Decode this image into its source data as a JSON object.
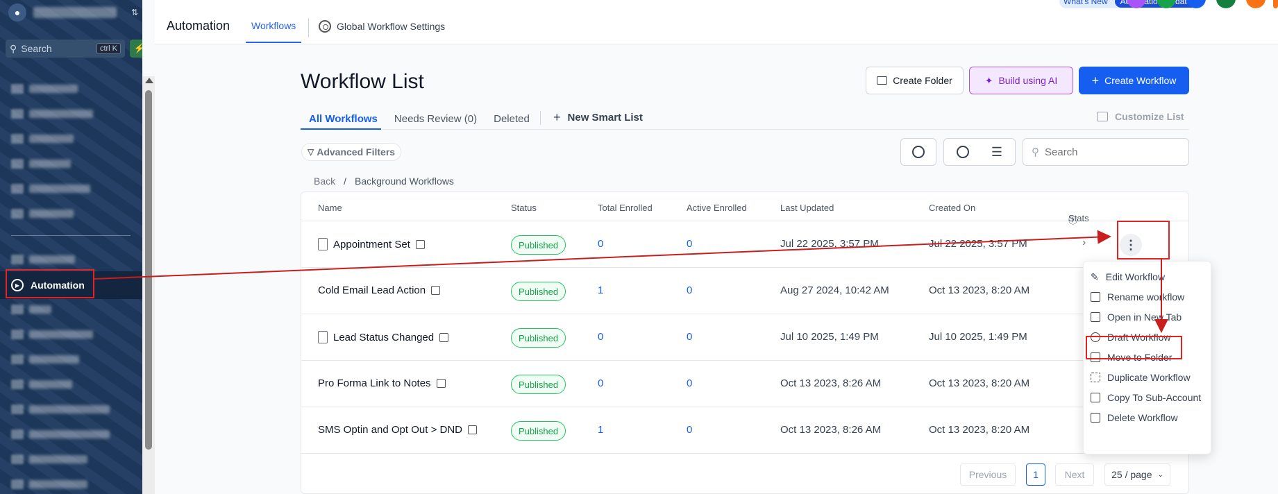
{
  "sidebar": {
    "search_placeholder": "Search",
    "search_shortcut": "ctrl K",
    "active_item": "Automation"
  },
  "header": {
    "app_title": "Automation",
    "tab_workflows": "Workflows",
    "tab_settings": "Global Workflow Settings",
    "whats_new": "What's New",
    "whats_new_badge": "Automation Updates"
  },
  "page": {
    "title": "Workflow List",
    "create_folder": "Create Folder",
    "build_ai": "Build using AI",
    "create_workflow": "Create Workflow",
    "tabs": {
      "all": "All Workflows",
      "review": "Needs Review (0)",
      "deleted": "Deleted"
    },
    "new_smart_list": "New Smart List",
    "customize_list": "Customize List",
    "advanced_filters": "Advanced Filters",
    "search_placeholder": "Search",
    "breadcrumb_back": "Back",
    "breadcrumb_sep": "/",
    "breadcrumb_current": "Background Workflows"
  },
  "table": {
    "headers": {
      "name": "Name",
      "status": "Status",
      "total": "Total Enrolled",
      "active": "Active Enrolled",
      "updated": "Last Updated",
      "created": "Created On",
      "stats": "Stats"
    },
    "rows": [
      {
        "name": "Appointment Set",
        "status": "Published",
        "total": "0",
        "active": "0",
        "updated": "Jul 22 2025, 3:57 PM",
        "created": "Jul 22 2025, 3:57 PM"
      },
      {
        "name": "Cold Email Lead Action",
        "status": "Published",
        "total": "1",
        "active": "0",
        "updated": "Aug 27 2024, 10:42 AM",
        "created": "Oct 13 2023, 8:20 AM"
      },
      {
        "name": "Lead Status Changed",
        "status": "Published",
        "total": "0",
        "active": "0",
        "updated": "Jul 10 2025, 1:49 PM",
        "created": "Jul 10 2025, 1:49 PM"
      },
      {
        "name": "Pro Forma Link to Notes",
        "status": "Published",
        "total": "0",
        "active": "0",
        "updated": "Oct 13 2023, 8:26 AM",
        "created": "Oct 13 2023, 8:20 AM"
      },
      {
        "name": "SMS Optin and Opt Out > DND",
        "status": "Published",
        "total": "1",
        "active": "0",
        "updated": "Oct 13 2023, 8:26 AM",
        "created": "Oct 13 2023, 8:20 AM"
      }
    ]
  },
  "pagination": {
    "previous": "Previous",
    "current": "1",
    "next": "Next",
    "per_page": "25 / page"
  },
  "context_menu": {
    "items": [
      "Edit Workflow",
      "Rename workflow",
      "Open in New Tab",
      "Draft Workflow",
      "Move to Folder",
      "Duplicate Workflow",
      "Copy To Sub-Account",
      "Delete Workflow"
    ],
    "highlighted": "Draft Workflow"
  },
  "colors": {
    "sidebar_bg": "#1e3a5f",
    "primary": "#155eef",
    "annotation_red": "#e02424",
    "published_green": "#16a34a"
  }
}
